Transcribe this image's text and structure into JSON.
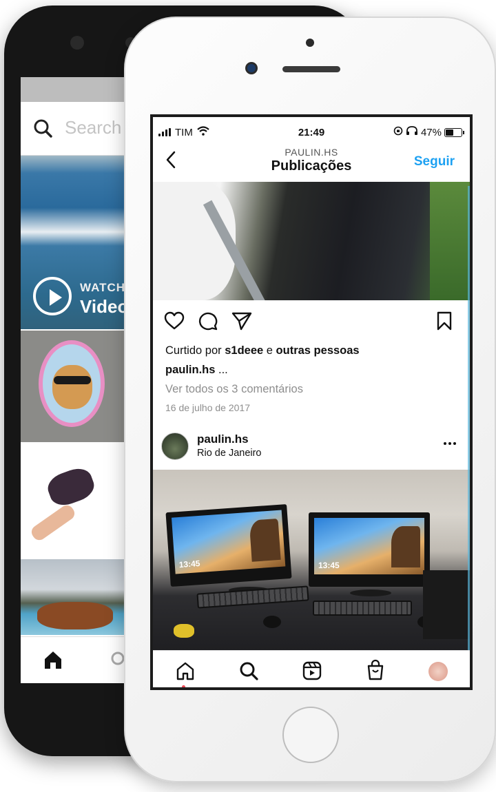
{
  "back_phone": {
    "search_placeholder": "Search",
    "video_tile": {
      "watch_label": "WATCH",
      "video_label": "Video"
    }
  },
  "status_bar": {
    "carrier": "TIM",
    "time": "21:49",
    "battery": "47%",
    "battery_level": 0.47
  },
  "header": {
    "username": "PAULIN.HS",
    "title": "Publicações",
    "follow_label": "Seguir"
  },
  "post1": {
    "likes_prefix": "Curtido por ",
    "liked_user": "s1deee",
    "likes_middle": " e ",
    "likes_others": "outras pessoas",
    "caption_user": "paulin.hs",
    "caption_text": " ...",
    "comments_link": "Ver todos os 3 comentários",
    "date": "16 de julho de 2017"
  },
  "post2": {
    "username": "paulin.hs",
    "location": "Rio de Janeiro",
    "monitor_time": "13:45"
  },
  "tabbar": {
    "items": [
      "home-icon",
      "search-icon",
      "reels-icon",
      "shop-icon",
      "profile-avatar"
    ],
    "active": "home"
  },
  "colors": {
    "accent": "#1da1f2",
    "notification_dot": "#ed4956",
    "secondary_text": "#8e8e8e"
  }
}
